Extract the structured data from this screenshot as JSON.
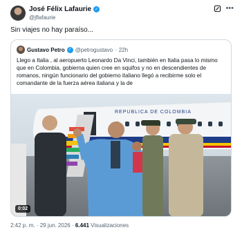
{
  "author": {
    "name": "José Félix Lafaurie",
    "handle": "@jflafaurie"
  },
  "tweet_text": "Sin viajes no hay paraíso...",
  "quoted": {
    "name": "Gustavo Petro",
    "handle": "@petrogustavo",
    "separator": "·",
    "time": "22h",
    "text": "Llego a Italia , al aeropuerto Leonardo Da Vinci, también en Italia pasa lo mismo que en Colombia, gobierna quien cree en squifos y no en descendientes de romanos, ningún funcionario del gobierno italiano llegó a recibirme solo el comandante de la fuerza aérea italiana y la de",
    "video": {
      "duration": "0:02",
      "plane_text": "REPUBLICA DE COLOMBIA"
    }
  },
  "meta": {
    "time": "2:42 p. m.",
    "sep1": "·",
    "date": "29 jun. 2026",
    "sep2": "·",
    "views_count": "6.441",
    "views_label": "Visualizaciones"
  },
  "icons": {
    "verified": "verified-badge-icon",
    "grok": "grok-icon",
    "more": "more-options-icon"
  },
  "colors": {
    "verified": "#1d9bf0",
    "secondary_text": "#536471",
    "border": "#cfd9de"
  }
}
